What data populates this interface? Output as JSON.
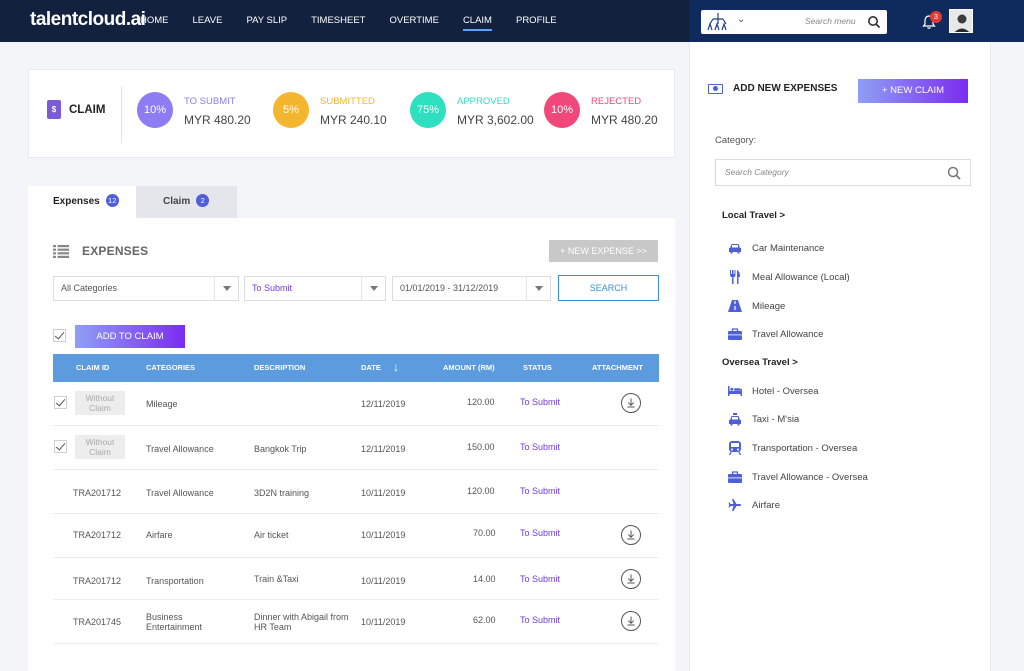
{
  "app": {
    "brand": "talentcloud.ai"
  },
  "nav": {
    "items": [
      {
        "label": "HOME"
      },
      {
        "label": "LEAVE"
      },
      {
        "label": "PAY SLIP"
      },
      {
        "label": "TIMESHEET"
      },
      {
        "label": "OVERTIME"
      },
      {
        "label": "CLAIM",
        "active": true
      },
      {
        "label": "PROFILE"
      }
    ],
    "search_placeholder": "Search menu",
    "notification_count": "3"
  },
  "summary": {
    "title": "CLAIM",
    "icon_glyph": "$",
    "stats": [
      {
        "percent": "10%",
        "label": "TO SUBMIT",
        "value": "MYR 480.20",
        "color": "#8e7cf2"
      },
      {
        "percent": "5%",
        "label": "SUBMITTED",
        "value": "MYR 240.10",
        "color": "#f5b62f"
      },
      {
        "percent": "75%",
        "label": "APPROVED",
        "value": "MYR 3,602.00",
        "color": "#2fe0c0"
      },
      {
        "percent": "10%",
        "label": "REJECTED",
        "value": "MYR 480.20",
        "color": "#f2477a"
      }
    ]
  },
  "tabs": [
    {
      "label": "Expenses",
      "count": "12",
      "active": true
    },
    {
      "label": "Claim",
      "count": "2",
      "active": false
    }
  ],
  "expenses": {
    "title": "EXPENSES",
    "new_expense_label": "+ NEW EXPENSE >>",
    "filters": {
      "category": "All Categories",
      "status": "To Submit",
      "date_range": "01/01/2019 - 31/12/2019",
      "search_label": "SEARCH"
    },
    "add_to_claim_label": "ADD TO CLAIM",
    "columns": {
      "claim_id": "CLAIM ID",
      "categories": "CATEGORIES",
      "description": "DESCRIPTION",
      "date": "DATE",
      "amount": "AMOUNT (RM)",
      "status": "STATUS",
      "attachment": "ATTACHMENT"
    },
    "without_claim_label": "Without Claim",
    "rows": [
      {
        "checked": true,
        "claim_id": "",
        "category": "Mileage",
        "description": "",
        "date": "12/11/2019",
        "amount": "120.00",
        "status": "To Submit",
        "attachment": true
      },
      {
        "checked": true,
        "claim_id": "",
        "category": "Travel Allowance",
        "description": "Bangkok Trip",
        "date": "12/11/2019",
        "amount": "150.00",
        "status": "To Submit",
        "attachment": false
      },
      {
        "checked": false,
        "claim_id": "TRA201712",
        "category": "Travel Allowance",
        "description": "3D2N training",
        "date": "10/11/2019",
        "amount": "120.00",
        "status": "To Submit",
        "attachment": false
      },
      {
        "checked": false,
        "claim_id": "TRA201712",
        "category": "Airfare",
        "description": "Air ticket",
        "date": "10/11/2019",
        "amount": "70.00",
        "status": "To Submit",
        "attachment": true
      },
      {
        "checked": false,
        "claim_id": "TRA201712",
        "category": "Transportation",
        "description": "Train &Taxi",
        "date": "10/11/2019",
        "amount": "14.00",
        "status": "To Submit",
        "attachment": true
      },
      {
        "checked": false,
        "claim_id": "TRA201745",
        "category": "Business Entertainment",
        "category_line1": "Business",
        "category_line2": "Entertainment",
        "description": "Dinner with Abigail from HR Team",
        "description_line1": "Dinner with Abigail from",
        "description_line2": "HR Team",
        "date": "10/11/2019",
        "amount": "62.00",
        "status": "To Submit",
        "attachment": true
      }
    ]
  },
  "sidebar": {
    "title": "ADD NEW EXPENSES",
    "new_claim_label": "+ NEW CLAIM",
    "category_label": "Category:",
    "category_search_placeholder": "Search Category",
    "groups": [
      {
        "title": "Local Travel >",
        "items": [
          {
            "label": "Car Maintenance",
            "icon": "car-icon"
          },
          {
            "label": "Meal Allowance (Local)",
            "icon": "cutlery-icon"
          },
          {
            "label": "Mileage",
            "icon": "road-icon"
          },
          {
            "label": "Travel Allowance",
            "icon": "briefcase-icon"
          }
        ]
      },
      {
        "title": "Oversea Travel >",
        "items": [
          {
            "label": "Hotel - Oversea",
            "icon": "bed-icon"
          },
          {
            "label": "Taxi - M'sia",
            "icon": "taxi-icon"
          },
          {
            "label": "Transportation - Oversea",
            "icon": "train-icon"
          },
          {
            "label": "Travel Allowance - Oversea",
            "icon": "briefcase-icon"
          },
          {
            "label": "Airfare",
            "icon": "plane-icon"
          }
        ]
      }
    ]
  }
}
